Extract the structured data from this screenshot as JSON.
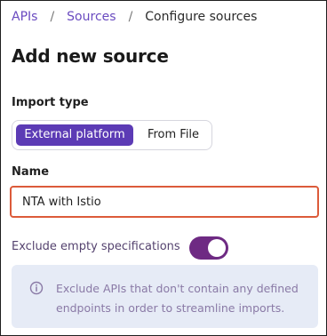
{
  "breadcrumb": {
    "items": [
      "APIs",
      "Sources",
      "Configure sources"
    ],
    "separator": "/"
  },
  "page": {
    "title": "Add new source"
  },
  "import_type": {
    "label": "Import type",
    "options": [
      "External platform",
      "From File"
    ],
    "selected": "External platform"
  },
  "name_field": {
    "label": "Name",
    "value": "NTA with Istio"
  },
  "exclude_toggle": {
    "label": "Exclude empty specifications",
    "enabled": true
  },
  "info": {
    "icon": "info-icon",
    "text": "Exclude APIs that don't contain any defined endpoints in order to streamline imports."
  },
  "colors": {
    "accent": "#5c3bb5",
    "toggle_on": "#6e2a83",
    "input_border_focus": "#dc5b3a",
    "info_bg": "#e6ebf6"
  }
}
